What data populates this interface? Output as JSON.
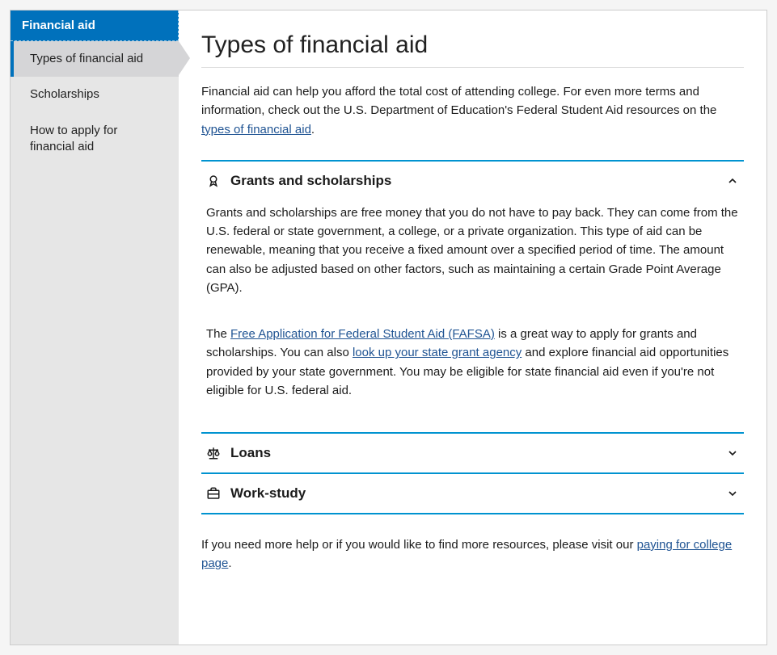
{
  "sidebar": {
    "header": "Financial aid",
    "items": [
      {
        "label": "Types of financial aid",
        "active": true
      },
      {
        "label": "Scholarships",
        "active": false
      },
      {
        "label": "How to apply for financial aid",
        "active": false
      }
    ]
  },
  "page": {
    "title": "Types of financial aid",
    "intro_start": "Financial aid can help you afford the total cost of attending college. For even more terms and information, check out the U.S. Department of Education's Federal Student Aid resources on the ",
    "intro_link": "types of financial aid",
    "intro_end": "."
  },
  "accordion": {
    "grants": {
      "title": "Grants and scholarships",
      "p1": "Grants and scholarships are free money that you do not have to pay back. They can come from the U.S. federal or state government, a college, or a private organization. This type of aid can be renewable, meaning that you receive a fixed amount over a specified period of time. The amount can also be adjusted based on other factors, such as maintaining a certain Grade Point Average (GPA).",
      "p2_a": "The ",
      "p2_link1": "Free Application for Federal Student Aid (FAFSA)",
      "p2_b": " is a great way to apply for grants and scholarships. You can also ",
      "p2_link2": "look up your state grant agency",
      "p2_c": " and explore financial aid opportunities provided by your state government. You may be eligible for state financial aid even if you're not eligible for U.S. federal aid."
    },
    "loans": {
      "title": "Loans"
    },
    "workstudy": {
      "title": "Work-study"
    }
  },
  "footer": {
    "a": "If you need more help or if you would like to find more resources, please visit our ",
    "link": "paying for college page",
    "b": "."
  }
}
